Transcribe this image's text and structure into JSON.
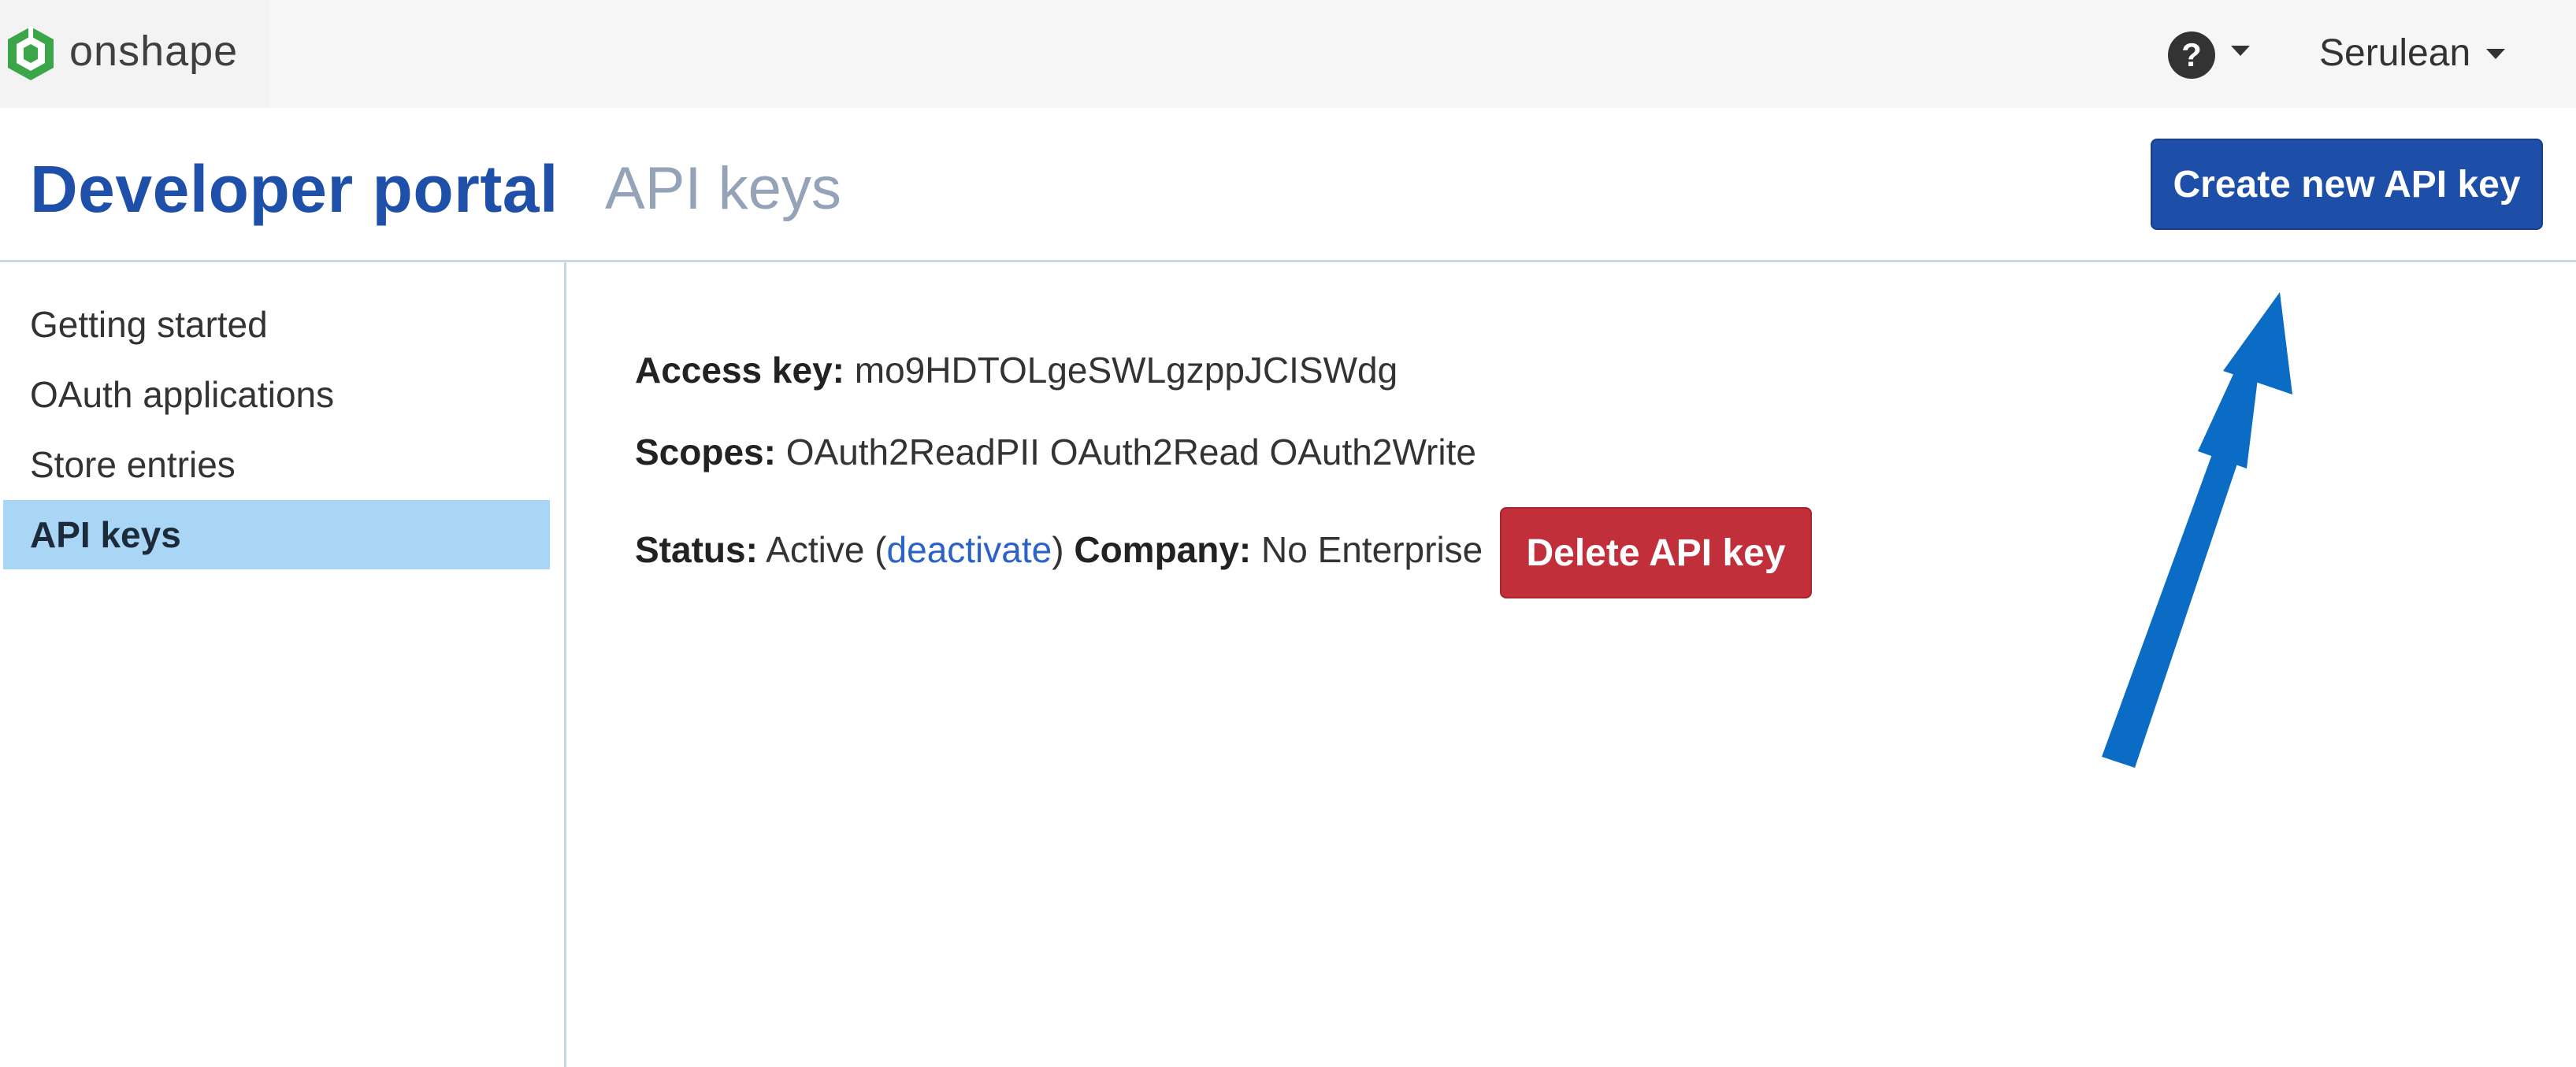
{
  "app": {
    "logo_text": "onshape",
    "brand_green": "#3aa647"
  },
  "topbar": {
    "help_icon": "question-circle-icon",
    "user_name": "Serulean"
  },
  "header": {
    "title": "Developer portal",
    "subtitle": "API keys",
    "create_label": "Create new API key",
    "accent": "#1d4fa8"
  },
  "sidebar": {
    "items": [
      {
        "label": "Getting started",
        "active": false
      },
      {
        "label": "OAuth applications",
        "active": false
      },
      {
        "label": "Store entries",
        "active": false
      },
      {
        "label": "API keys",
        "active": true
      }
    ],
    "active_color": "#a8d6f4"
  },
  "key": {
    "access_label": "Access key:",
    "access_value": "mo9HDTOLgeSWLgzppJCISWdg",
    "scopes_label": "Scopes:",
    "scopes_value": "OAuth2ReadPII OAuth2Read OAuth2Write",
    "status_label": "Status:",
    "status_value": "Active (",
    "deactivate_link": "deactivate",
    "status_close": ")",
    "company_label": "Company:",
    "company_value": "No Enterprise",
    "delete_label": "Delete API key",
    "delete_color": "#c1303a"
  },
  "annotation": {
    "arrow_color": "#0a6cc4",
    "points_to": "create-new-api-key-button"
  }
}
